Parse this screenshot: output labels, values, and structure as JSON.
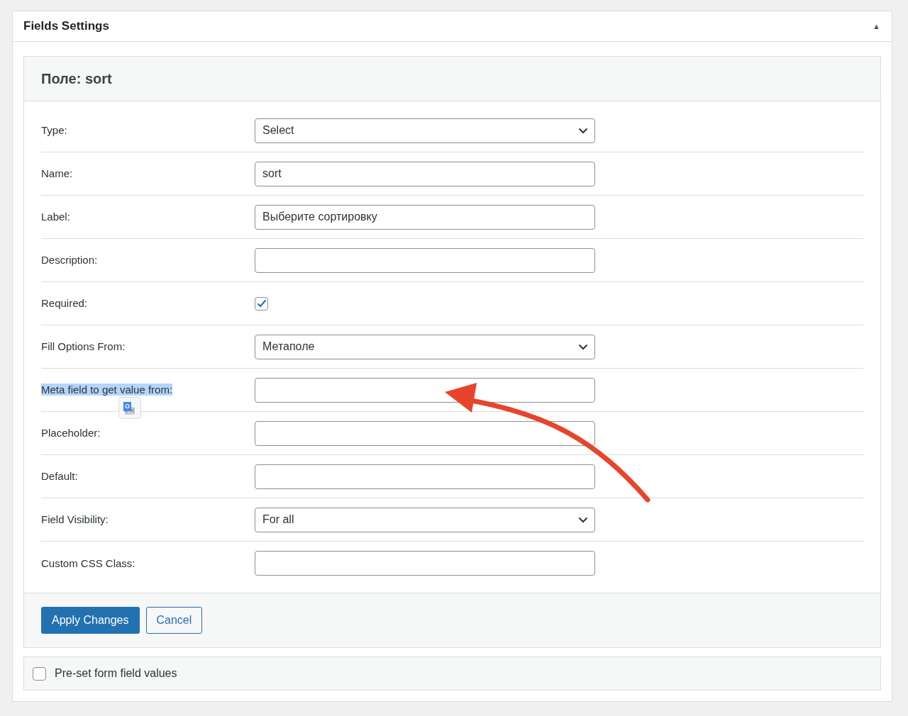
{
  "panel": {
    "title": "Fields Settings",
    "collapse_glyph": "▲"
  },
  "field_box": {
    "title": "Поле: sort"
  },
  "rows": [
    {
      "label": "Type:",
      "kind": "select",
      "value": "Select",
      "text_selected": false
    },
    {
      "label": "Name:",
      "kind": "text",
      "value": "sort",
      "text_selected": false
    },
    {
      "label": "Label:",
      "kind": "text",
      "value": "Выберите сортировку",
      "text_selected": false
    },
    {
      "label": "Description:",
      "kind": "text",
      "value": "",
      "text_selected": false
    },
    {
      "label": "Required:",
      "kind": "checkbox",
      "checked": true,
      "text_selected": false
    },
    {
      "label": "Fill Options From:",
      "kind": "select",
      "value": "Метаполе",
      "text_selected": false
    },
    {
      "label": "Meta field to get value from:",
      "kind": "text",
      "value": "",
      "text_selected": true
    },
    {
      "label": "Placeholder:",
      "kind": "text",
      "value": "",
      "text_selected": false
    },
    {
      "label": "Default:",
      "kind": "text",
      "value": "",
      "text_selected": false
    },
    {
      "label": "Field Visibility:",
      "kind": "select",
      "value": "For all",
      "text_selected": false
    },
    {
      "label": "Custom CSS Class:",
      "kind": "text",
      "value": "",
      "text_selected": false
    }
  ],
  "buttons": [
    {
      "label": "Apply Changes",
      "kind": "primary"
    },
    {
      "label": "Cancel",
      "kind": "secondary"
    }
  ],
  "preset": {
    "label": "Pre-set form field values",
    "checked": false
  }
}
